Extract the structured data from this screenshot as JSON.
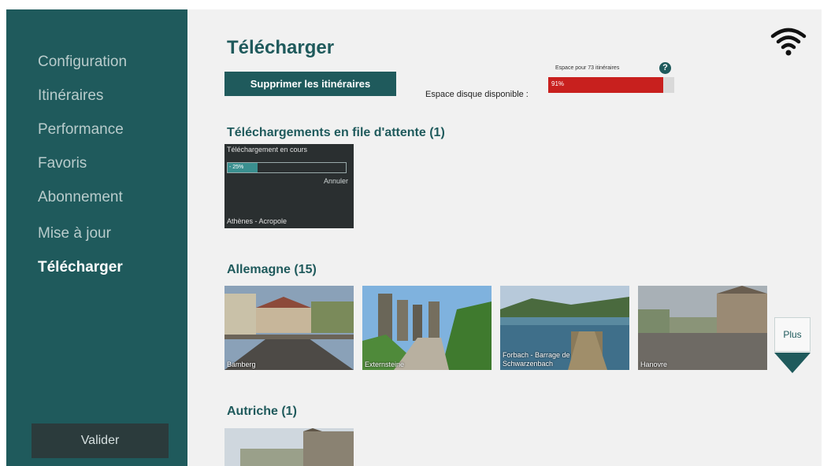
{
  "sidebar": {
    "items": [
      {
        "label": "Configuration"
      },
      {
        "label": "Itinéraires"
      },
      {
        "label": "Performance"
      },
      {
        "label": "Favoris"
      },
      {
        "label": "Abonnement"
      },
      {
        "label": "Mise à jour"
      },
      {
        "label": "Télécharger",
        "active": true
      }
    ],
    "validate_label": "Valider"
  },
  "main": {
    "title": "Télécharger",
    "delete_button": "Supprimer les itinéraires",
    "space_note": "Espace pour 73 itinéraires",
    "help_icon": "?",
    "disk_label": "Espace disque disponible :",
    "disk_percent_text": "91%",
    "disk_percent": 0.91,
    "wifi_icon": "wifi-icon",
    "queue": {
      "title": "Téléchargements en file d'attente (1)",
      "item": {
        "status": "Téléchargement en cours",
        "progress_text": "- 25%",
        "progress": 0.25,
        "cancel": "Annuler",
        "name": "Athènes - Acropole"
      }
    },
    "germany": {
      "title": "Allemagne (15)",
      "items": [
        {
          "label": "Bamberg"
        },
        {
          "label": "Externsteine"
        },
        {
          "label": "Forbach - Barrage de Schwarzenbach"
        },
        {
          "label": "Hanovre"
        }
      ]
    },
    "more_label": "Plus",
    "austria": {
      "title": "Autriche (1)"
    }
  },
  "colors": {
    "accent": "#1f5a5c",
    "disk_bar": "#c8201e",
    "sidebar_bg": "#1f5a5c",
    "main_bg": "#f1f1f1"
  }
}
